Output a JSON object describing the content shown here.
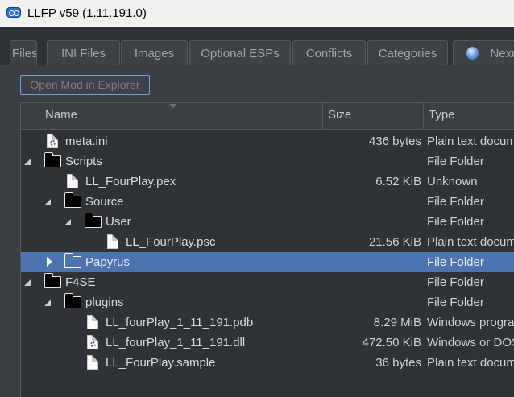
{
  "window": {
    "title": "LLFP v59 (1.11.191.0)"
  },
  "tabs": [
    "Files",
    "INI Files",
    "Images",
    "Optional ESPs",
    "Conflicts",
    "Categories",
    "Nexus"
  ],
  "toolbar": {
    "open_button": "Open Mod in Explorer"
  },
  "tree": {
    "columns": [
      "Name",
      "Size",
      "Type"
    ],
    "rows": [
      {
        "name": "meta.ini",
        "size": "436 bytes",
        "type": "Plain text document",
        "icon": "ini-file-icon",
        "depth": 0,
        "expander": "none"
      },
      {
        "name": "Scripts",
        "size": "",
        "type": "File Folder",
        "icon": "folder-icon",
        "depth": 0,
        "expander": "open"
      },
      {
        "name": "LL_FourPlay.pex",
        "size": "6.52 KiB",
        "type": "Unknown",
        "icon": "file-icon",
        "depth": 1,
        "expander": "none"
      },
      {
        "name": "Source",
        "size": "",
        "type": "File Folder",
        "icon": "folder-icon",
        "depth": 1,
        "expander": "open"
      },
      {
        "name": "User",
        "size": "",
        "type": "File Folder",
        "icon": "folder-icon",
        "depth": 2,
        "expander": "open"
      },
      {
        "name": "LL_FourPlay.psc",
        "size": "21.56 KiB",
        "type": "Plain text document",
        "icon": "file-icon",
        "depth": 3,
        "expander": "none"
      },
      {
        "name": "Papyrus",
        "size": "",
        "type": "File Folder",
        "icon": "folder-icon",
        "depth": 1,
        "expander": "closed",
        "selected": true
      },
      {
        "name": "F4SE",
        "size": "",
        "type": "File Folder",
        "icon": "folder-icon",
        "depth": 0,
        "expander": "open"
      },
      {
        "name": "plugins",
        "size": "",
        "type": "File Folder",
        "icon": "folder-icon",
        "depth": 1,
        "expander": "open"
      },
      {
        "name": "LL_fourPlay_1_11_191.pdb",
        "size": "8.29 MiB",
        "type": "Windows program database",
        "icon": "file-icon",
        "depth": 2,
        "expander": "none"
      },
      {
        "name": "LL_fourPlay_1_11_191.dll",
        "size": "472.50 KiB",
        "type": "Windows or DOS library",
        "icon": "dll-file-icon",
        "depth": 2,
        "expander": "none"
      },
      {
        "name": "LL_FourPlay.sample",
        "size": "36 bytes",
        "type": "Plain text document",
        "icon": "file-icon",
        "depth": 2,
        "expander": "none"
      }
    ]
  },
  "colors": {
    "selection": "#4c72b0",
    "background": "#3a3d42",
    "accent": "#6da1d8"
  }
}
